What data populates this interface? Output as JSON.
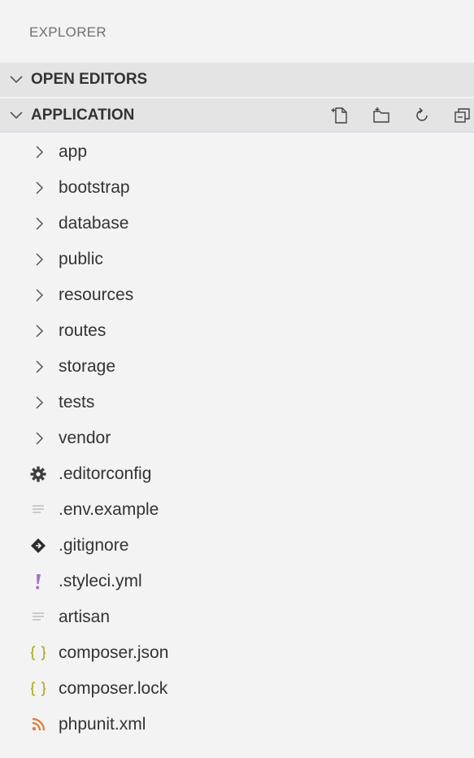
{
  "explorer": {
    "title": "EXPLORER"
  },
  "sections": {
    "open_editors": {
      "label": "OPEN EDITORS"
    },
    "application": {
      "label": "APPLICATION"
    }
  },
  "actions": [
    {
      "name": "new-file-icon"
    },
    {
      "name": "new-folder-icon"
    },
    {
      "name": "refresh-icon"
    },
    {
      "name": "collapse-all-icon"
    }
  ],
  "folders": [
    {
      "label": "app"
    },
    {
      "label": "bootstrap"
    },
    {
      "label": "database"
    },
    {
      "label": "public"
    },
    {
      "label": "resources"
    },
    {
      "label": "routes"
    },
    {
      "label": "storage"
    },
    {
      "label": "tests"
    },
    {
      "label": "vendor"
    }
  ],
  "files": [
    {
      "label": ".editorconfig",
      "icon": "gear-icon",
      "color": "#3c3c3c"
    },
    {
      "label": ".env.example",
      "icon": "text-lines-icon",
      "color": "#c5c5c5"
    },
    {
      "label": ".gitignore",
      "icon": "git-diamond-icon",
      "color": "#2d2d2d"
    },
    {
      "label": ".styleci.yml",
      "icon": "exclamation-icon",
      "color": "#a074c4"
    },
    {
      "label": "artisan",
      "icon": "text-lines-icon",
      "color": "#c5c5c5"
    },
    {
      "label": "composer.json",
      "icon": "braces-icon",
      "color": "#b7b73b"
    },
    {
      "label": "composer.lock",
      "icon": "braces-icon",
      "color": "#b7b73b"
    },
    {
      "label": "phpunit.xml",
      "icon": "rss-icon",
      "color": "#e37933"
    }
  ]
}
